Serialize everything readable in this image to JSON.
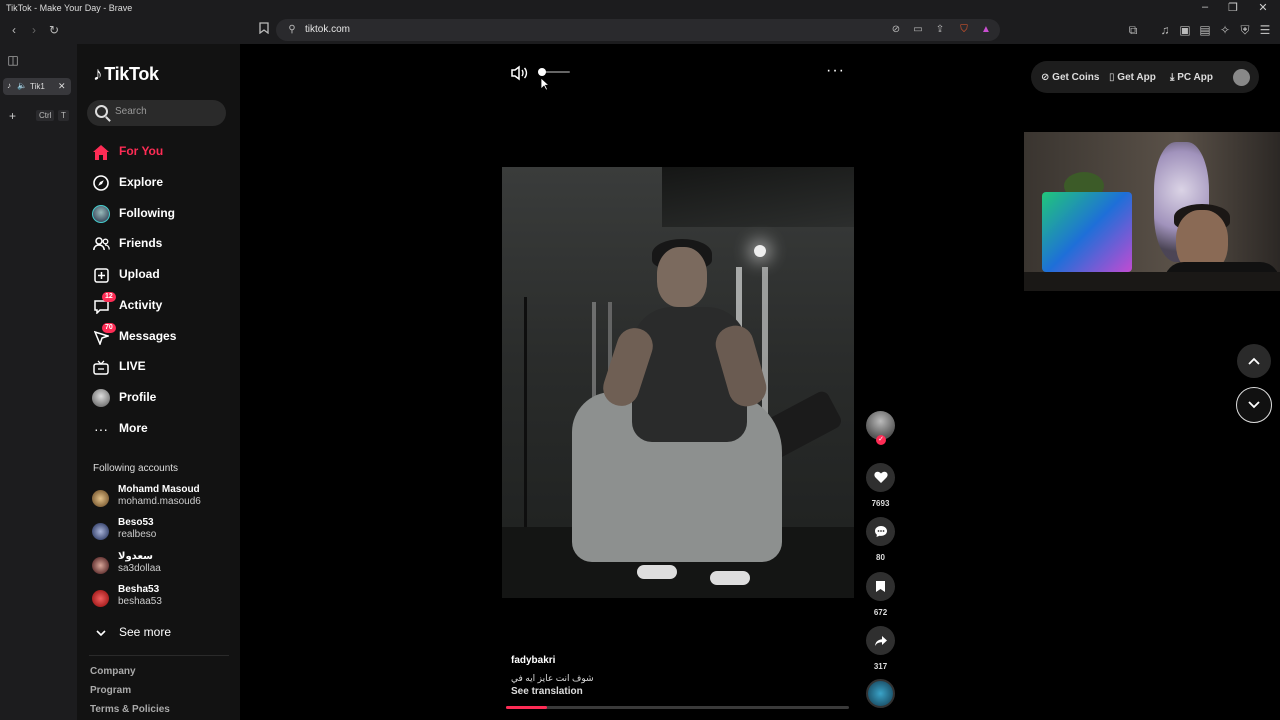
{
  "window": {
    "title": "TikTok - Make Your Day - Brave"
  },
  "browser": {
    "url": "tiktok.com",
    "tab": {
      "label": "Tik1"
    },
    "new_tab_shortcut": {
      "ctrl": "Ctrl",
      "key": "T"
    }
  },
  "brand": {
    "name": "TikTok"
  },
  "search": {
    "placeholder": "Search"
  },
  "nav": {
    "items": [
      {
        "label": "For You",
        "icon": "home-icon",
        "active": true
      },
      {
        "label": "Explore",
        "icon": "compass-icon"
      },
      {
        "label": "Following",
        "icon": "following-avatar-icon"
      },
      {
        "label": "Friends",
        "icon": "friends-icon"
      },
      {
        "label": "Upload",
        "icon": "plus-square-icon"
      },
      {
        "label": "Activity",
        "icon": "activity-icon",
        "badge": "12"
      },
      {
        "label": "Messages",
        "icon": "messages-icon",
        "badge": "70"
      },
      {
        "label": "LIVE",
        "icon": "live-tv-icon"
      },
      {
        "label": "Profile",
        "icon": "profile-avatar-icon"
      },
      {
        "label": "More",
        "icon": "more-dots-icon"
      }
    ]
  },
  "following_accounts": {
    "title": "Following accounts",
    "accounts": [
      {
        "name": "Mohamd Masoud",
        "handle": "mohamd.masoud6"
      },
      {
        "name": "Beso53",
        "handle": "realbeso"
      },
      {
        "name": "سعدولا",
        "handle": "sa3dollaa"
      },
      {
        "name": "Besha53",
        "handle": "beshaa53"
      }
    ],
    "see_more": "See more"
  },
  "footer": {
    "links": [
      "Company",
      "Program",
      "Terms & Policies"
    ]
  },
  "video": {
    "author": "fadybakri",
    "caption": "شوف انت عايز ايه في",
    "see_translation": "See translation",
    "progress": 0.12,
    "volume": 0.1
  },
  "actions": {
    "likes": "7693",
    "comments": "80",
    "saves": "672",
    "shares": "317"
  },
  "topbar": {
    "get_coins": "Get Coins",
    "get_app": "Get App",
    "pc_app": "PC App"
  },
  "colors": {
    "accent": "#fe2c55",
    "background": "#000000",
    "nav_bg": "#121212"
  }
}
